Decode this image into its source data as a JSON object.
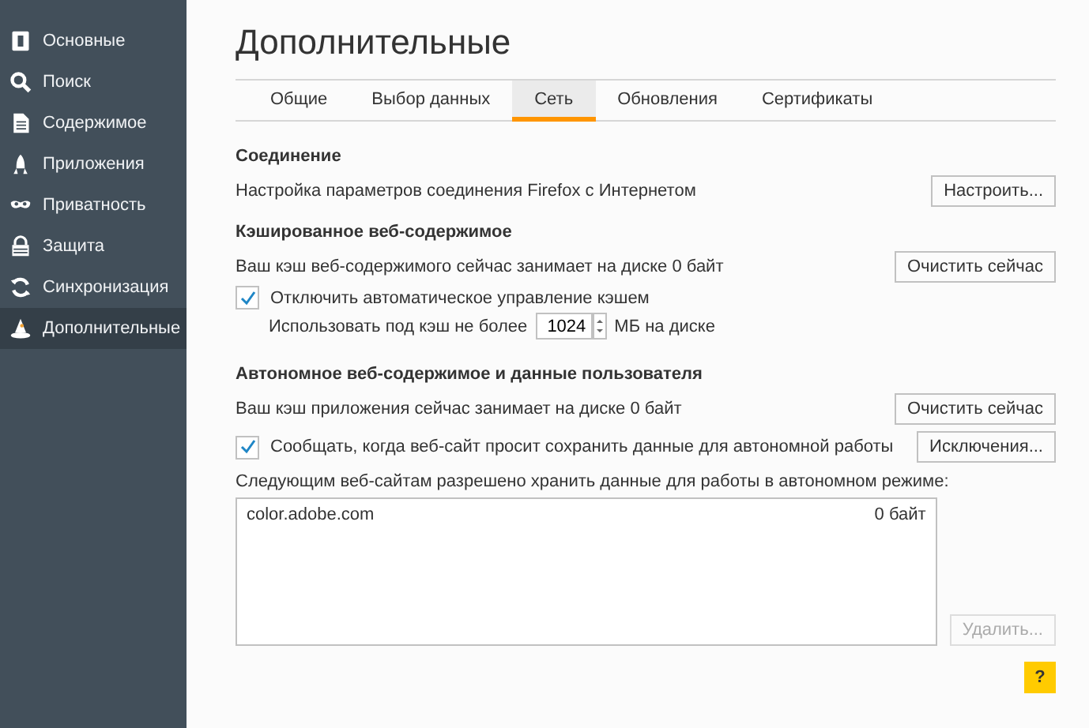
{
  "sidebar": {
    "items": [
      {
        "label": "Основные",
        "selected": false
      },
      {
        "label": "Поиск",
        "selected": false
      },
      {
        "label": "Содержимое",
        "selected": false
      },
      {
        "label": "Приложения",
        "selected": false
      },
      {
        "label": "Приватность",
        "selected": false
      },
      {
        "label": "Защита",
        "selected": false
      },
      {
        "label": "Синхронизация",
        "selected": false
      },
      {
        "label": "Дополнительные",
        "selected": true
      }
    ]
  },
  "title": "Дополнительные",
  "tabs": [
    {
      "label": "Общие",
      "selected": false
    },
    {
      "label": "Выбор данных",
      "selected": false
    },
    {
      "label": "Сеть",
      "selected": true
    },
    {
      "label": "Обновления",
      "selected": false
    },
    {
      "label": "Сертификаты",
      "selected": false
    }
  ],
  "connection": {
    "heading": "Соединение",
    "text": "Настройка параметров соединения Firefox с Интернетом",
    "button": "Настроить..."
  },
  "cache": {
    "heading": "Кэшированное веб-содержимое",
    "text": "Ваш кэш веб-содержимого сейчас занимает на диске 0 байт",
    "button": "Очистить сейчас",
    "override": {
      "label": "Отключить автоматическое управление кэшем",
      "checked": true
    },
    "limit_label": "Использовать под кэш не более",
    "limit_value": "1024",
    "limit_unit": "МБ на диске"
  },
  "offline": {
    "heading": "Автономное веб-содержимое и данные пользователя",
    "text": "Ваш кэш приложения сейчас занимает на диске 0 байт",
    "button": "Очистить сейчас",
    "notify": {
      "label": "Сообщать, когда веб-сайт просит сохранить данные для автономной работы",
      "checked": true
    },
    "exceptions_button": "Исключения...",
    "list_label": "Следующим веб-сайтам разрешено хранить данные для работы в автономном режиме:",
    "sites": [
      {
        "site": "color.adobe.com",
        "size": "0 байт"
      }
    ],
    "remove_button": {
      "label": "Удалить...",
      "disabled": true
    }
  },
  "help_button": "?"
}
